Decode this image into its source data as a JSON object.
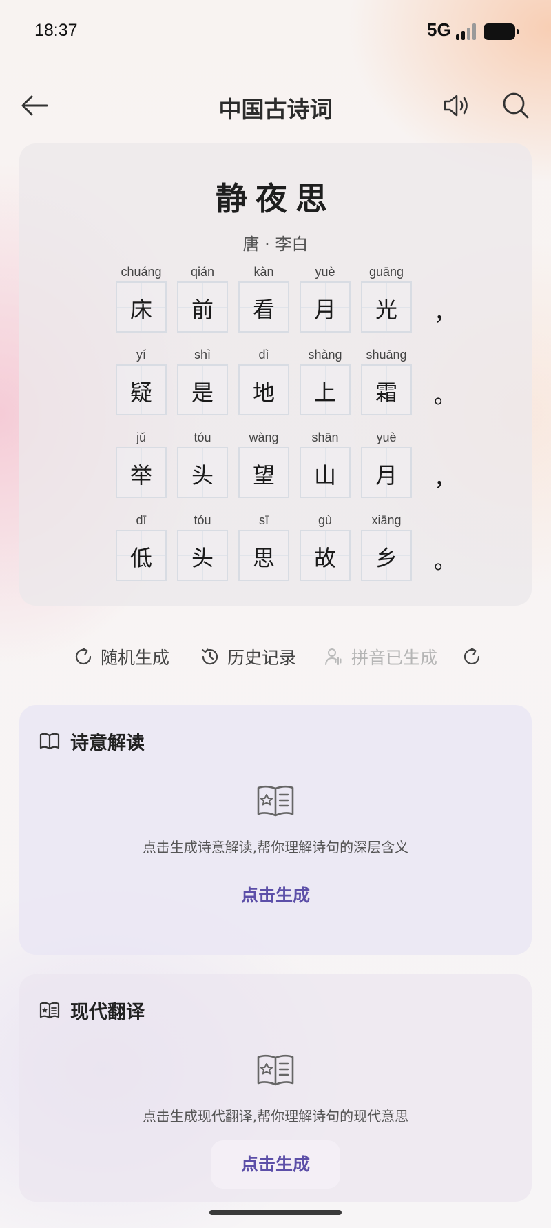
{
  "status_bar": {
    "time": "18:37",
    "network": "5G",
    "signal_bars_active": 2,
    "signal_bars_total": 4
  },
  "header": {
    "title": "中国古诗词",
    "back_icon": "arrow-left-icon",
    "speaker_icon": "speaker-icon",
    "search_icon": "search-icon"
  },
  "poem": {
    "title": "静夜思",
    "author": "唐 · 李白",
    "lines": [
      {
        "chars": [
          [
            "chuáng",
            "床"
          ],
          [
            "qián",
            "前"
          ],
          [
            "kàn",
            "看"
          ],
          [
            "yuè",
            "月"
          ],
          [
            "guāng",
            "光"
          ]
        ],
        "punct": "，"
      },
      {
        "chars": [
          [
            "yí",
            "疑"
          ],
          [
            "shì",
            "是"
          ],
          [
            "dì",
            "地"
          ],
          [
            "shàng",
            "上"
          ],
          [
            "shuāng",
            "霜"
          ]
        ],
        "punct": "。"
      },
      {
        "chars": [
          [
            "jǔ",
            "举"
          ],
          [
            "tóu",
            "头"
          ],
          [
            "wàng",
            "望"
          ],
          [
            "shān",
            "山"
          ],
          [
            "yuè",
            "月"
          ]
        ],
        "punct": "，"
      },
      {
        "chars": [
          [
            "dī",
            "低"
          ],
          [
            "tóu",
            "头"
          ],
          [
            "sī",
            "思"
          ],
          [
            "gù",
            "故"
          ],
          [
            "xiāng",
            "乡"
          ]
        ],
        "punct": "。"
      }
    ]
  },
  "actions": {
    "random": "随机生成",
    "history": "历史记录",
    "pinyin": "拼音已生成",
    "refresh_icon": "refresh-icon"
  },
  "interpretation": {
    "title": "诗意解读",
    "description": "点击生成诗意解读,帮你理解诗句的深层含义",
    "button": "点击生成"
  },
  "translation": {
    "title": "现代翻译",
    "description": "点击生成现代翻译,帮你理解诗句的现代意思",
    "button": "点击生成"
  },
  "colors": {
    "accent": "#5c4fa8",
    "text_primary": "#222222",
    "disabled": "#b5b5b5"
  }
}
